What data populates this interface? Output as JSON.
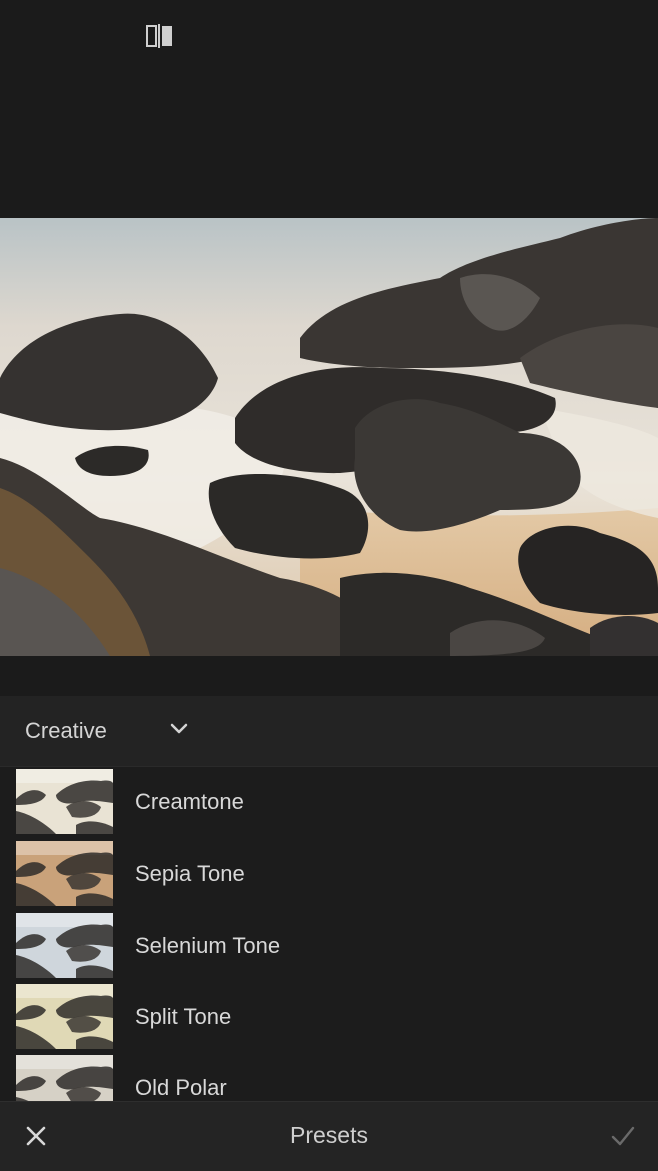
{
  "toolbar": {
    "compare_icon": "before-after-compare-icon"
  },
  "photo": {
    "subject": "",
    "colors": {
      "sand": "#d8b48c",
      "water": "#e6e2da",
      "rock": "#2e2c2a"
    }
  },
  "category": {
    "label": "Creative",
    "icon": "chevron-down-icon"
  },
  "presets": [
    {
      "label": "Creamtone",
      "tint": "#e9e3d4"
    },
    {
      "label": "Sepia Tone",
      "tint": "#c9a27a"
    },
    {
      "label": "Selenium Tone",
      "tint": "#cfd6dc"
    },
    {
      "label": "Split Tone",
      "tint": "#e0d9b6"
    },
    {
      "label": "Old Polar",
      "tint": "#d6d1c6"
    }
  ],
  "bottom": {
    "title": "Presets",
    "cancel_icon": "close-icon",
    "confirm_icon": "checkmark-icon"
  },
  "colors": {
    "background": "#1a1a1a",
    "text": "#d8d8d8",
    "checkmark": "#6a6a6a"
  }
}
